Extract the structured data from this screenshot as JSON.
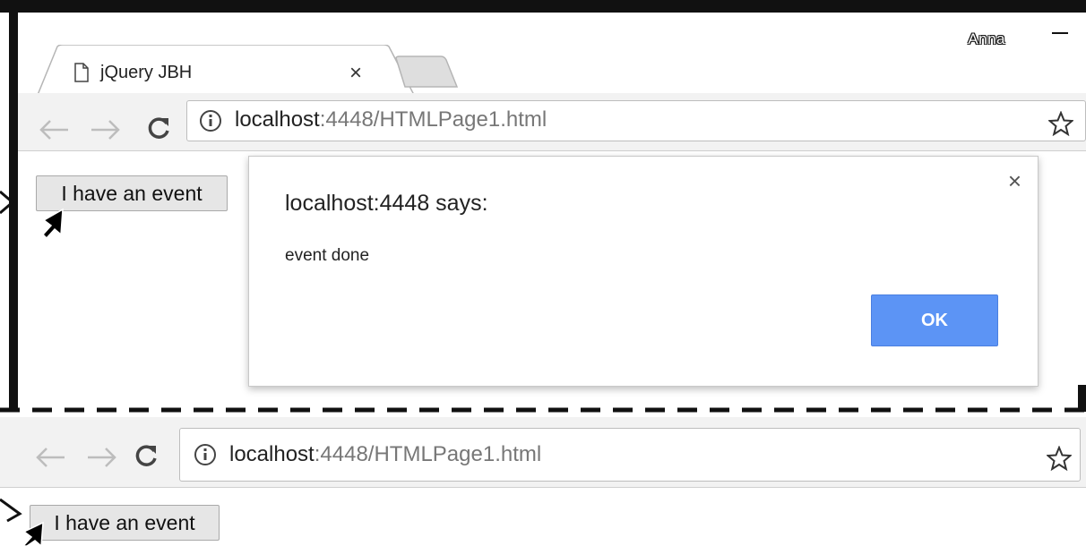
{
  "browser": {
    "user_name": "Anna",
    "tab": {
      "title": "jQuery JBH",
      "close_glyph": "×"
    },
    "address": {
      "host": "localhost",
      "path": ":4448/HTMLPage1.html"
    }
  },
  "page": {
    "event_button_label": "I have an event"
  },
  "dialog": {
    "title": "localhost:4448 says:",
    "message": "event done",
    "ok_label": "OK",
    "close_glyph": "×"
  },
  "colors": {
    "ok_button": "#5c94f5",
    "toolbar": "#f2f2f2",
    "frame": "#111111"
  },
  "icons": [
    "page-icon",
    "tab-close-icon",
    "back-arrow-icon",
    "forward-arrow-icon",
    "reload-icon",
    "info-icon",
    "star-icon",
    "cursor-arrow-icon",
    "minimize-icon"
  ]
}
